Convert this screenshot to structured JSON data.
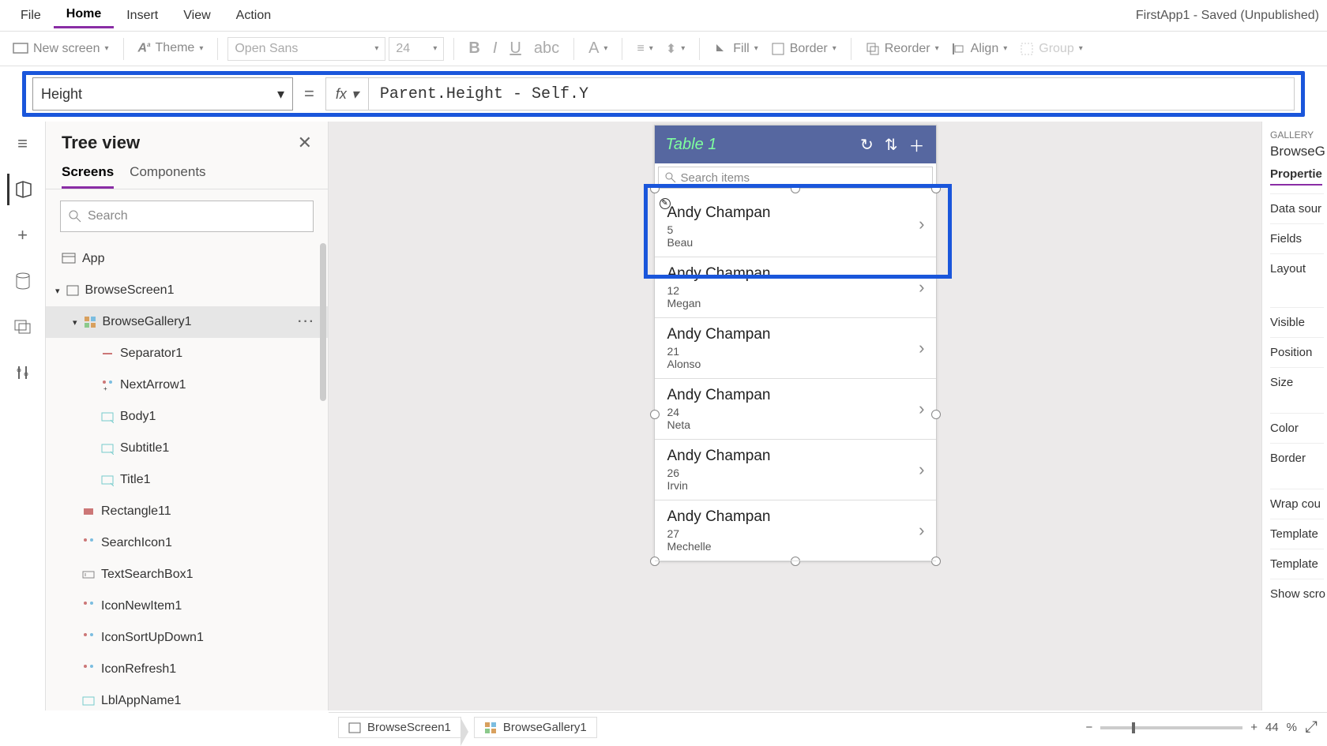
{
  "app_title": "FirstApp1 - Saved (Unpublished)",
  "menu": {
    "file": "File",
    "home": "Home",
    "insert": "Insert",
    "view": "View",
    "action": "Action"
  },
  "ribbon": {
    "new_screen": "New screen",
    "theme": "Theme",
    "font": "Open Sans",
    "size": "24",
    "fill": "Fill",
    "border": "Border",
    "reorder": "Reorder",
    "align": "Align",
    "group": "Group"
  },
  "formula": {
    "property": "Height",
    "fx": "fx",
    "expression": "Parent.Height - Self.Y"
  },
  "tree": {
    "title": "Tree view",
    "tabs": {
      "screens": "Screens",
      "components": "Components"
    },
    "search_placeholder": "Search",
    "nodes": {
      "app": "App",
      "browse_screen": "BrowseScreen1",
      "browse_gallery": "BrowseGallery1",
      "separator": "Separator1",
      "next_arrow": "NextArrow1",
      "body": "Body1",
      "subtitle": "Subtitle1",
      "title": "Title1",
      "rectangle": "Rectangle11",
      "search_icon": "SearchIcon1",
      "text_search": "TextSearchBox1",
      "icon_new": "IconNewItem1",
      "icon_sort": "IconSortUpDown1",
      "icon_refresh": "IconRefresh1",
      "lbl_app": "LblAppName1"
    }
  },
  "device": {
    "title": "Table 1",
    "search_placeholder": "Search items",
    "items": [
      {
        "title": "Andy Champan",
        "n": "5",
        "sub": "Beau"
      },
      {
        "title": "Andy Champan",
        "n": "12",
        "sub": "Megan"
      },
      {
        "title": "Andy Champan",
        "n": "21",
        "sub": "Alonso"
      },
      {
        "title": "Andy Champan",
        "n": "24",
        "sub": "Neta"
      },
      {
        "title": "Andy Champan",
        "n": "26",
        "sub": "Irvin"
      },
      {
        "title": "Andy Champan",
        "n": "27",
        "sub": "Mechelle"
      }
    ]
  },
  "props": {
    "category": "GALLERY",
    "name": "BrowseG",
    "tab": "Propertie",
    "rows": [
      "Data sour",
      "Fields",
      "Layout",
      "Visible",
      "Position",
      "Size",
      "Color",
      "Border",
      "Wrap cou",
      "Template",
      "Template",
      "Show scro"
    ]
  },
  "breadcrumb": {
    "screen": "BrowseScreen1",
    "gallery": "BrowseGallery1"
  },
  "zoom": {
    "value": "44",
    "pct": "%"
  }
}
